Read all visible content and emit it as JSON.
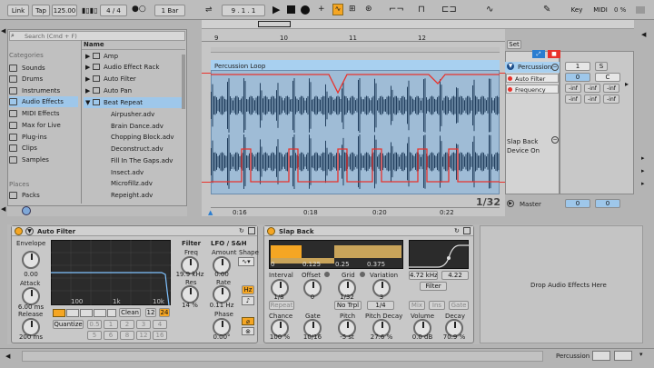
{
  "transport": {
    "link": "Link",
    "tap": "Tap",
    "tempo": "125.00",
    "signature": "4 / 4",
    "quantize": "1 Bar",
    "position": "9 .  1 .  1",
    "key": "Key",
    "midi": "MIDI",
    "cpu": "0 %"
  },
  "browser": {
    "search_placeholder": "Search (Cmd + F)",
    "categories_title": "Categories",
    "categories": [
      "Sounds",
      "Drums",
      "Instruments",
      "Audio Effects",
      "MIDI Effects",
      "Max for Live",
      "Plug-ins",
      "Clips",
      "Samples"
    ],
    "places_title": "Places",
    "places": [
      "Packs"
    ],
    "name_header": "Name",
    "items": [
      "Amp",
      "Audio Effect Rack",
      "Auto Filter",
      "Auto Pan",
      "Beat Repeat",
      "Airpusher.adv",
      "Brain Dance.adv",
      "Chopping Block.adv",
      "Deconstruct.adv",
      "Fill In The Gaps.adv",
      "Insect.adv",
      "Microfillz.adv",
      "Repeight.adv"
    ]
  },
  "arrangement": {
    "bar_labels": [
      "9",
      "10",
      "11",
      "12"
    ],
    "time_labels": [
      "0:16",
      "0:18",
      "0:20",
      "0:22"
    ],
    "clip_name": "Percussion Loop",
    "zoom": "1/32",
    "set_label": "Set"
  },
  "mixer": {
    "track": "Percussion",
    "params": [
      "Auto Filter",
      "Frequency"
    ],
    "track_num": "1",
    "solo": "S",
    "vol": "0",
    "pan": "C",
    "inf": "-inf",
    "group": "Slap Back",
    "device_on": "Device On",
    "master": "Master",
    "master_vol": "0",
    "master_pan": "0"
  },
  "auto_filter": {
    "title": "Auto Filter",
    "envelope": "Envelope",
    "env_amount": "0.00",
    "attack": "Attack",
    "attack_val": "6.00 ms",
    "release": "Release",
    "release_val": "200 ms",
    "graph_labels": [
      "100",
      "1k",
      "10k"
    ],
    "filter": "Filter",
    "freq": "Freq",
    "freq_val": "19.9 kHz",
    "res": "Res",
    "res_val": "14 %",
    "clean": "Clean",
    "oct_12": "12",
    "oct_24": "24",
    "quantize": "Quantize",
    "q_values": [
      "0.5",
      "1",
      "2",
      "3",
      "4",
      "5",
      "6",
      "8",
      "12",
      "16"
    ],
    "lfo": "LFO / S&H",
    "amount": "Amount",
    "amount_val": "0.00",
    "shape": "Shape",
    "rate": "Rate",
    "rate_val": "0.11 Hz",
    "hz": "Hz",
    "phase": "Phase",
    "phase_val": "0.00°"
  },
  "slap_back": {
    "title": "Slap Back",
    "grid_marks": [
      "0",
      "0.125",
      "0.25",
      "0.375"
    ],
    "interval": "Interval",
    "interval_val": "1/8",
    "offset": "Offset",
    "offset_val": "0",
    "grid": "Grid",
    "grid_val": "1/32",
    "variation": "Variation",
    "variation_val": "3",
    "repeat": "Repeat",
    "no_trpl": "No Trpl",
    "grid_sel": "1/4",
    "freq_val": "4.72 kHz",
    "width_val": "4.22",
    "filter": "Filter",
    "mix": "Mix",
    "ins": "Ins",
    "gate_btn": "Gate",
    "chance": "Chance",
    "chance_val": "100 %",
    "gate": "Gate",
    "gate_val": "10/16",
    "pitch": "Pitch",
    "pitch_val": "-5 st",
    "pitch_decay": "Pitch Decay",
    "pitch_decay_val": "27.6 %",
    "volume": "Volume",
    "volume_val": "0.0 dB",
    "decay": "Decay",
    "decay_val": "70.9 %"
  },
  "drop": {
    "text": "Drop Audio Effects Here"
  },
  "status": {
    "track": "Percussion"
  },
  "colors": {
    "accent": "#f5a623",
    "blue": "#9ec7ea",
    "wave": "#1f3a55",
    "automation": "#e8322c"
  }
}
